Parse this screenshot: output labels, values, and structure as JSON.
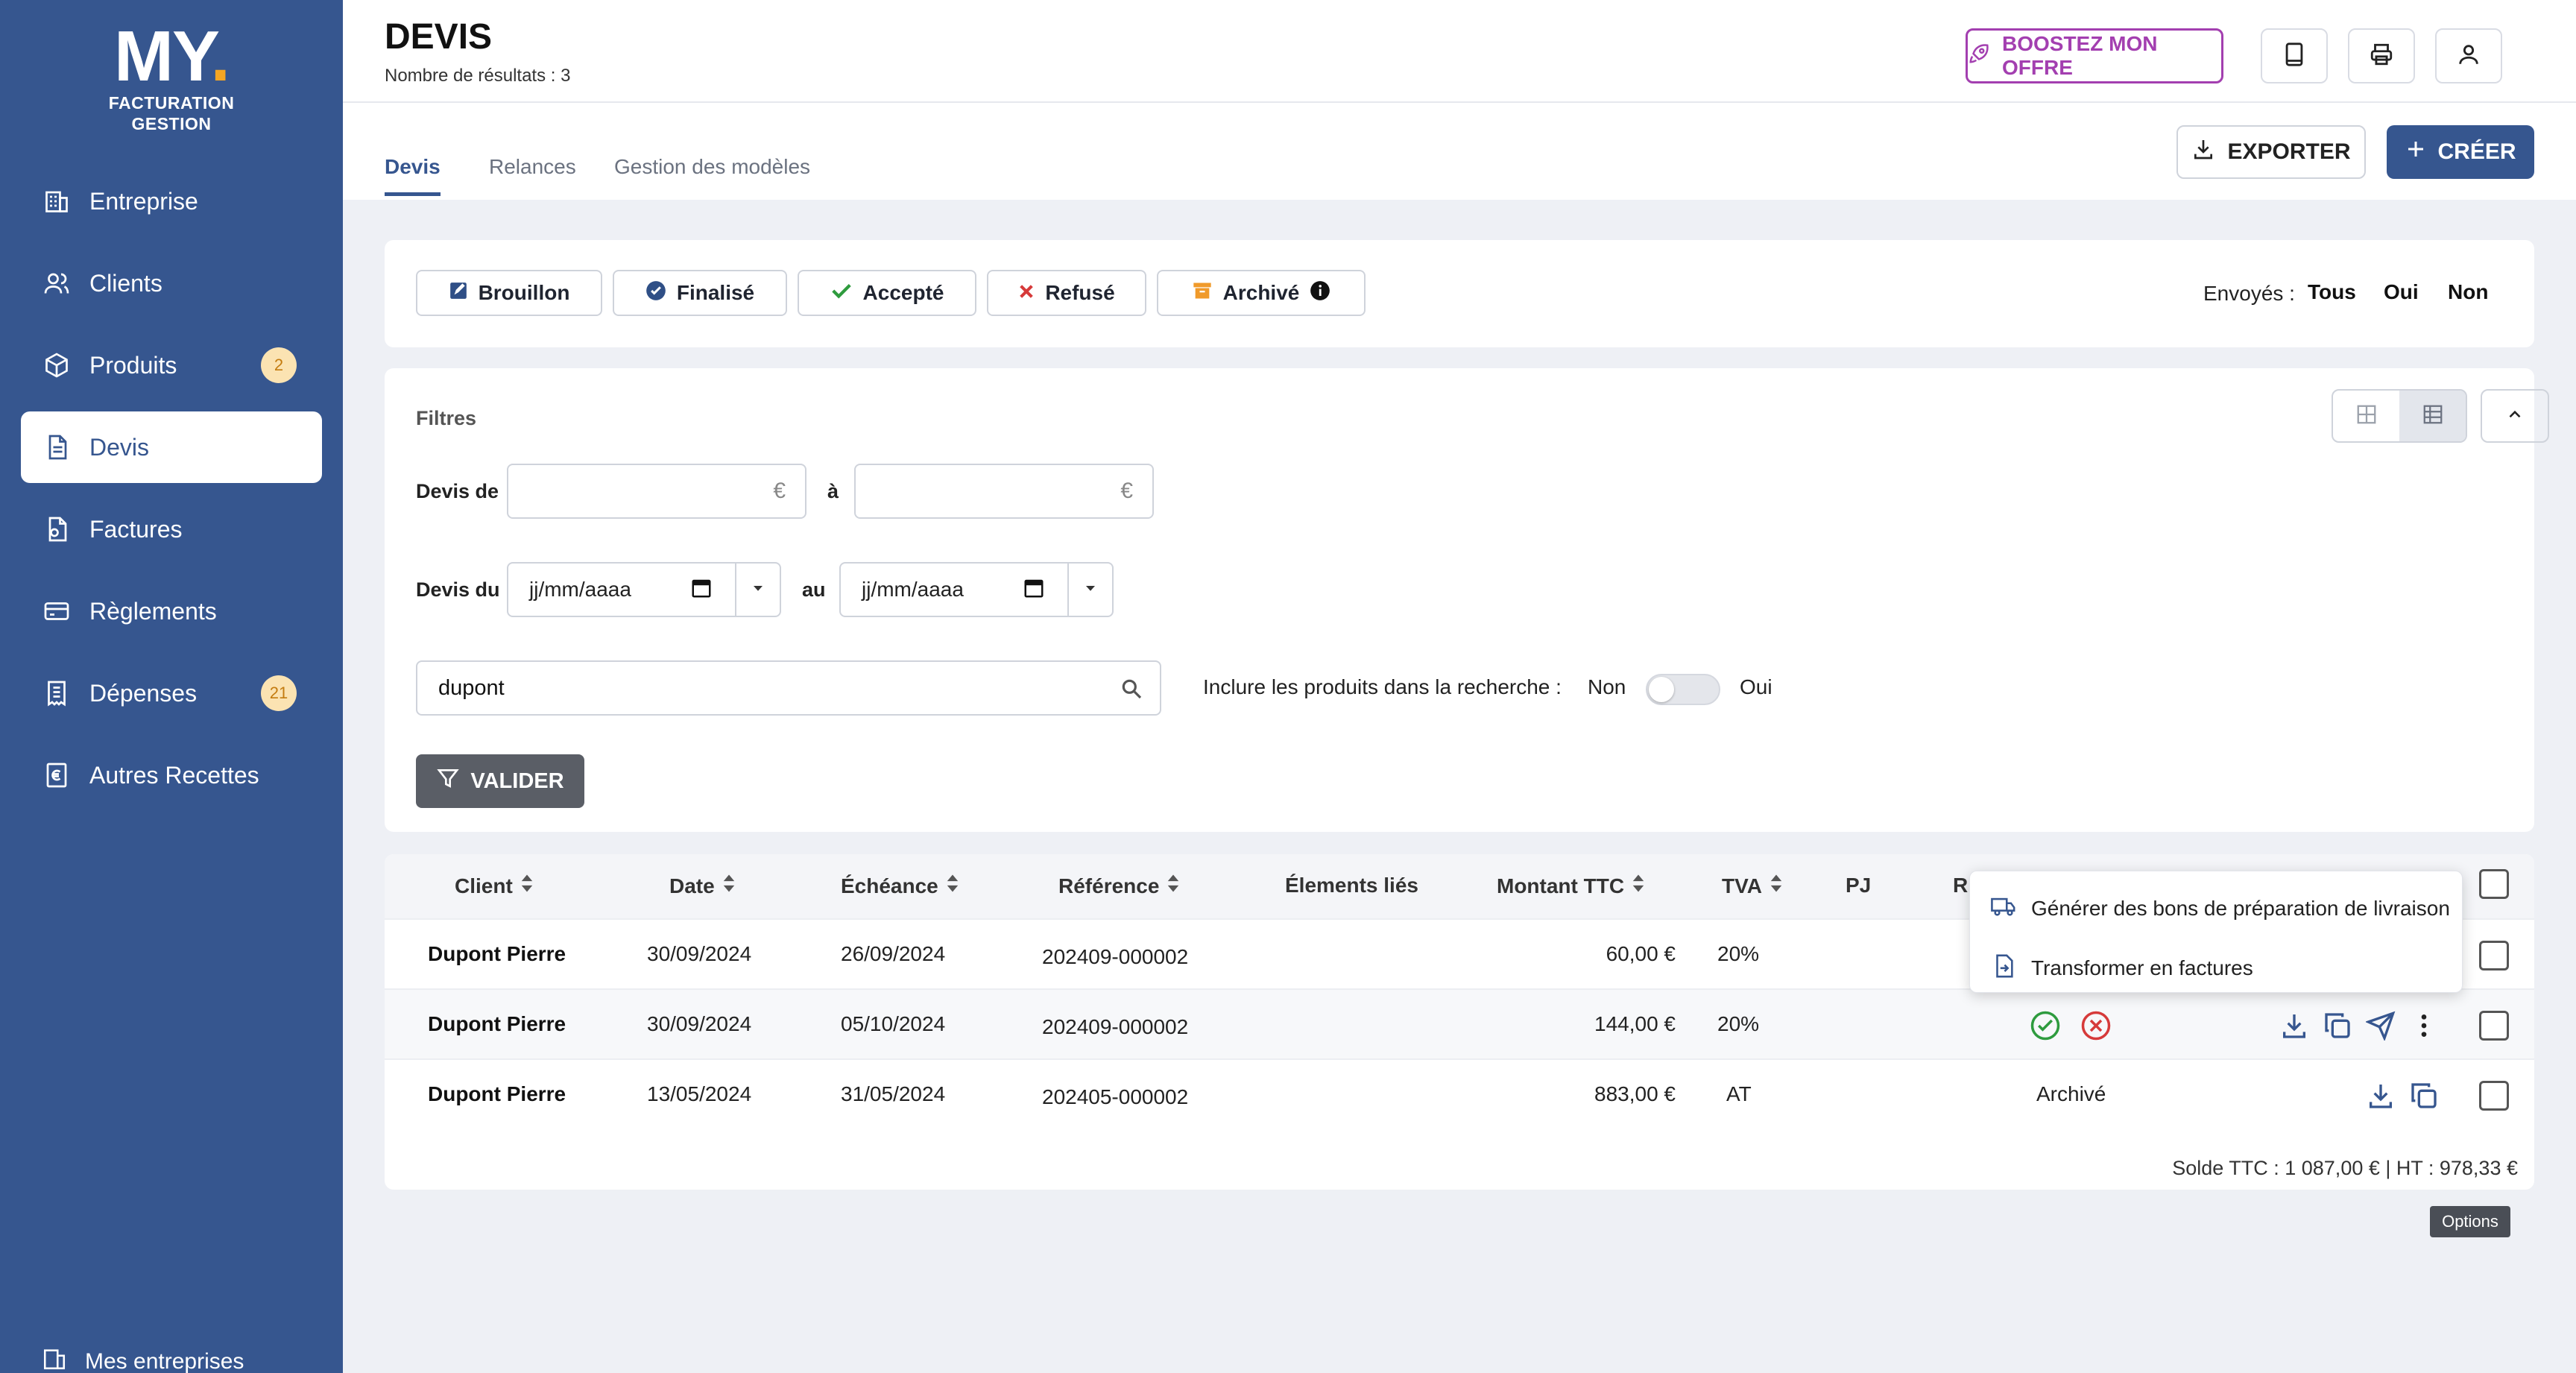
{
  "logo": {
    "main": "MY",
    "line1": "FACTURATION",
    "line2": "GESTION"
  },
  "sidebar": {
    "items": [
      {
        "label": "Entreprise",
        "icon": "building-icon"
      },
      {
        "label": "Clients",
        "icon": "users-icon"
      },
      {
        "label": "Produits",
        "icon": "box-icon",
        "badge": "2"
      },
      {
        "label": "Devis",
        "icon": "document-icon",
        "active": true
      },
      {
        "label": "Factures",
        "icon": "invoice-icon"
      },
      {
        "label": "Règlements",
        "icon": "card-icon"
      },
      {
        "label": "Dépenses",
        "icon": "receipt-icon",
        "badge": "21"
      },
      {
        "label": "Autres Recettes",
        "icon": "euro-doc-icon"
      }
    ],
    "bottom_label": "Mes entreprises"
  },
  "header": {
    "title": "DEVIS",
    "results": "Nombre de résultats : 3",
    "boost_label": "BOOSTEZ MON OFFRE"
  },
  "tabs": [
    {
      "label": "Devis",
      "active": true
    },
    {
      "label": "Relances"
    },
    {
      "label": "Gestion des modèles"
    }
  ],
  "actions": {
    "export_label": "EXPORTER",
    "create_label": "CRÉER"
  },
  "statuses": [
    {
      "label": "Brouillon",
      "icon": "draft-icon",
      "color": "#2f4f86"
    },
    {
      "label": "Finalisé",
      "icon": "check-circle-icon",
      "color": "#2f4f86"
    },
    {
      "label": "Accepté",
      "icon": "check-icon",
      "color": "#2e9b3e"
    },
    {
      "label": "Refusé",
      "icon": "x-icon",
      "color": "#d63a3a"
    },
    {
      "label": "Archivé",
      "icon": "archive-icon",
      "color": "#f09a2a"
    }
  ],
  "sent_filter": {
    "label": "Envoyés :",
    "options": [
      "Tous",
      "Oui",
      "Non"
    ]
  },
  "filters": {
    "title": "Filtres",
    "amount_from_label": "Devis de",
    "amount_to_label": "à",
    "currency": "€",
    "date_from_label": "Devis du",
    "date_to_label": "au",
    "date_placeholder": "jj/mm/aaaa",
    "search_value": "dupont",
    "include_products_label": "Inclure les produits dans la recherche :",
    "toggle_off": "Non",
    "toggle_on": "Oui",
    "validate_label": "VALIDER"
  },
  "table": {
    "columns": [
      "Client",
      "Date",
      "Échéance",
      "Référence",
      "Élements liés",
      "Montant TTC",
      "TVA",
      "PJ",
      "R"
    ],
    "rows": [
      {
        "client": "Dupont Pierre",
        "date": "30/09/2024",
        "due": "26/09/2024",
        "ref": "202409-000002",
        "amount": "60,00 €",
        "tva": "20%",
        "status": ""
      },
      {
        "client": "Dupont Pierre",
        "date": "30/09/2024",
        "due": "05/10/2024",
        "ref": "202409-000002",
        "amount": "144,00 €",
        "tva": "20%",
        "status": ""
      },
      {
        "client": "Dupont Pierre",
        "date": "13/05/2024",
        "due": "31/05/2024",
        "ref": "202405-000002",
        "amount": "883,00 €",
        "tva": "AT",
        "status": "Archivé"
      }
    ],
    "total": "Solde TTC : 1 087,00 € | HT : 978,33 €"
  },
  "menu": {
    "items": [
      {
        "label": "Générer des bons de préparation de livraison",
        "icon": "truck-icon"
      },
      {
        "label": "Transformer en factures",
        "icon": "file-transfer-icon"
      }
    ]
  },
  "tooltip": "Options"
}
